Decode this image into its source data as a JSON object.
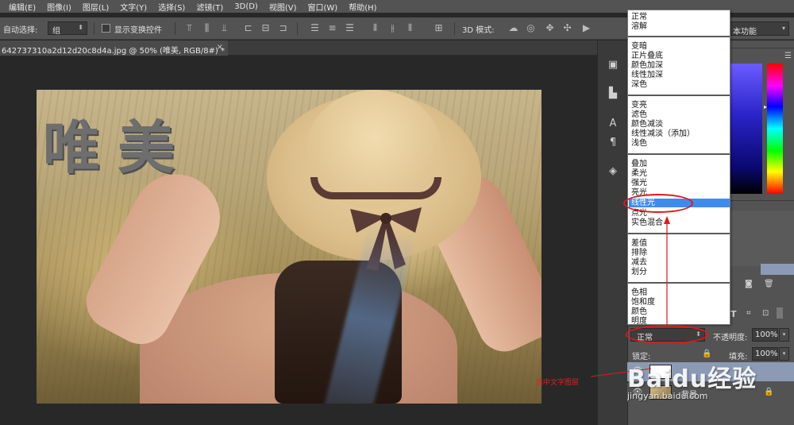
{
  "menu": [
    "编辑(E)",
    "图像(I)",
    "图层(L)",
    "文字(Y)",
    "选择(S)",
    "滤镜(T)",
    "3D(D)",
    "视图(V)",
    "窗口(W)",
    "帮助(H)"
  ],
  "options": {
    "auto_select_label": "自动选择:",
    "auto_select_value": "组",
    "show_transform_label": "显示变换控件",
    "mode_3d_label": "3D 模式:",
    "workspace": "本功能"
  },
  "document_tab": {
    "title": "642737310a2d12d20c8d4a.jpg @ 50% (唯美, RGB/8#) *",
    "close": "×"
  },
  "canvas": {
    "watermark_text": "唯美"
  },
  "annotation": {
    "select_text_layer": "选中文字图层"
  },
  "blend_modes": {
    "groups": [
      [
        "正常",
        "溶解"
      ],
      [
        "变暗",
        "正片叠底",
        "颜色加深",
        "线性加深",
        "深色"
      ],
      [
        "变亮",
        "滤色",
        "颜色减淡",
        "线性减淡（添加）",
        "浅色"
      ],
      [
        "叠加",
        "柔光",
        "强光",
        "亮光",
        "线性光",
        "点光",
        "实色混合"
      ],
      [
        "差值",
        "排除",
        "减去",
        "划分"
      ],
      [
        "色相",
        "饱和度",
        "颜色",
        "明度"
      ]
    ],
    "selected": "线性光"
  },
  "layers_panel": {
    "blend_value": "正常",
    "opacity_label": "不透明度:",
    "opacity_value": "100%",
    "lock_label": "锁定:",
    "fill_label": "填充:",
    "fill_value": "100%",
    "text_layer_icon": "T",
    "bg_layer_name": "背景"
  },
  "site_watermark": {
    "main": "Baidu经验",
    "sub": "jingyan.baidu.com"
  },
  "colors": {
    "chrome": "#535353",
    "canvas_bg": "#282828",
    "highlight": "#3e8bf0",
    "annotation_red": "#e01818"
  }
}
